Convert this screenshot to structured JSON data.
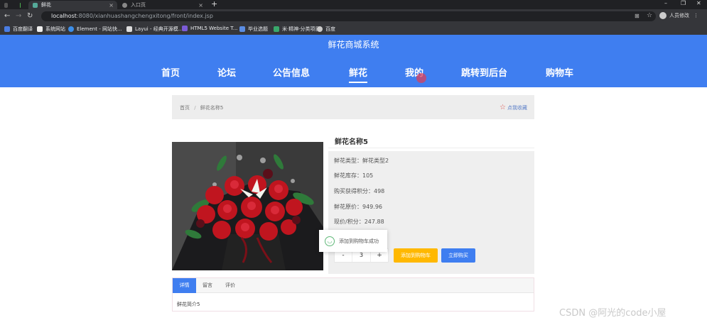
{
  "browser": {
    "tabs": [
      {
        "title": "鲜花",
        "active": true
      },
      {
        "title": "入口页",
        "active": false
      }
    ],
    "url_host": "localhost",
    "url_rest": ":8080/xianhuashangchengxitong/front/index.jsp",
    "profile_label": "人员修改",
    "bookmarks": [
      "百度翻译",
      "系统网站",
      "Element - 网站快...",
      "Layui - 经典开源模...",
      "HTML5 Website T...",
      "毕业选题",
      "米·精神·分类项目",
      "百度"
    ]
  },
  "site": {
    "title": "鲜花商城系统",
    "menu": [
      {
        "label": "首页",
        "active": false
      },
      {
        "label": "论坛",
        "active": false
      },
      {
        "label": "公告信息",
        "active": false
      },
      {
        "label": "鲜花",
        "active": true
      },
      {
        "label": "我的",
        "active": false
      },
      {
        "label": "跳转到后台",
        "active": false
      },
      {
        "label": "购物车",
        "active": false
      }
    ]
  },
  "breadcrumb": {
    "home": "首页",
    "separator": "/",
    "current": "鲜花名称5"
  },
  "favorite_label": "点我收藏",
  "product": {
    "name": "鲜花名称5",
    "type_label": "鲜花类型：",
    "type_value": "鲜花类型2",
    "stock_label": "鲜花库存：",
    "stock_value": "105",
    "points_label": "购买获得积分：",
    "points_value": "498",
    "orig_price_label": "鲜花原价：",
    "orig_price_value": "949.96",
    "price_label": "现价/积分：",
    "price_value": "247.88"
  },
  "quantity": {
    "minus": "-",
    "value": "3",
    "plus": "+"
  },
  "buttons": {
    "add_cart": "添加到购物车",
    "buy_now": "立即购买"
  },
  "toast": {
    "message": "添加到购物车成功"
  },
  "detail_tabs": {
    "tabs": [
      "详情",
      "留言",
      "评价"
    ],
    "active_index": 0,
    "content": "鲜花简介5"
  },
  "watermark": "CSDN @阿光的code小屋",
  "colors": {
    "primary": "#3f7ef0",
    "warning": "#ffb800",
    "success": "#5fb878"
  }
}
